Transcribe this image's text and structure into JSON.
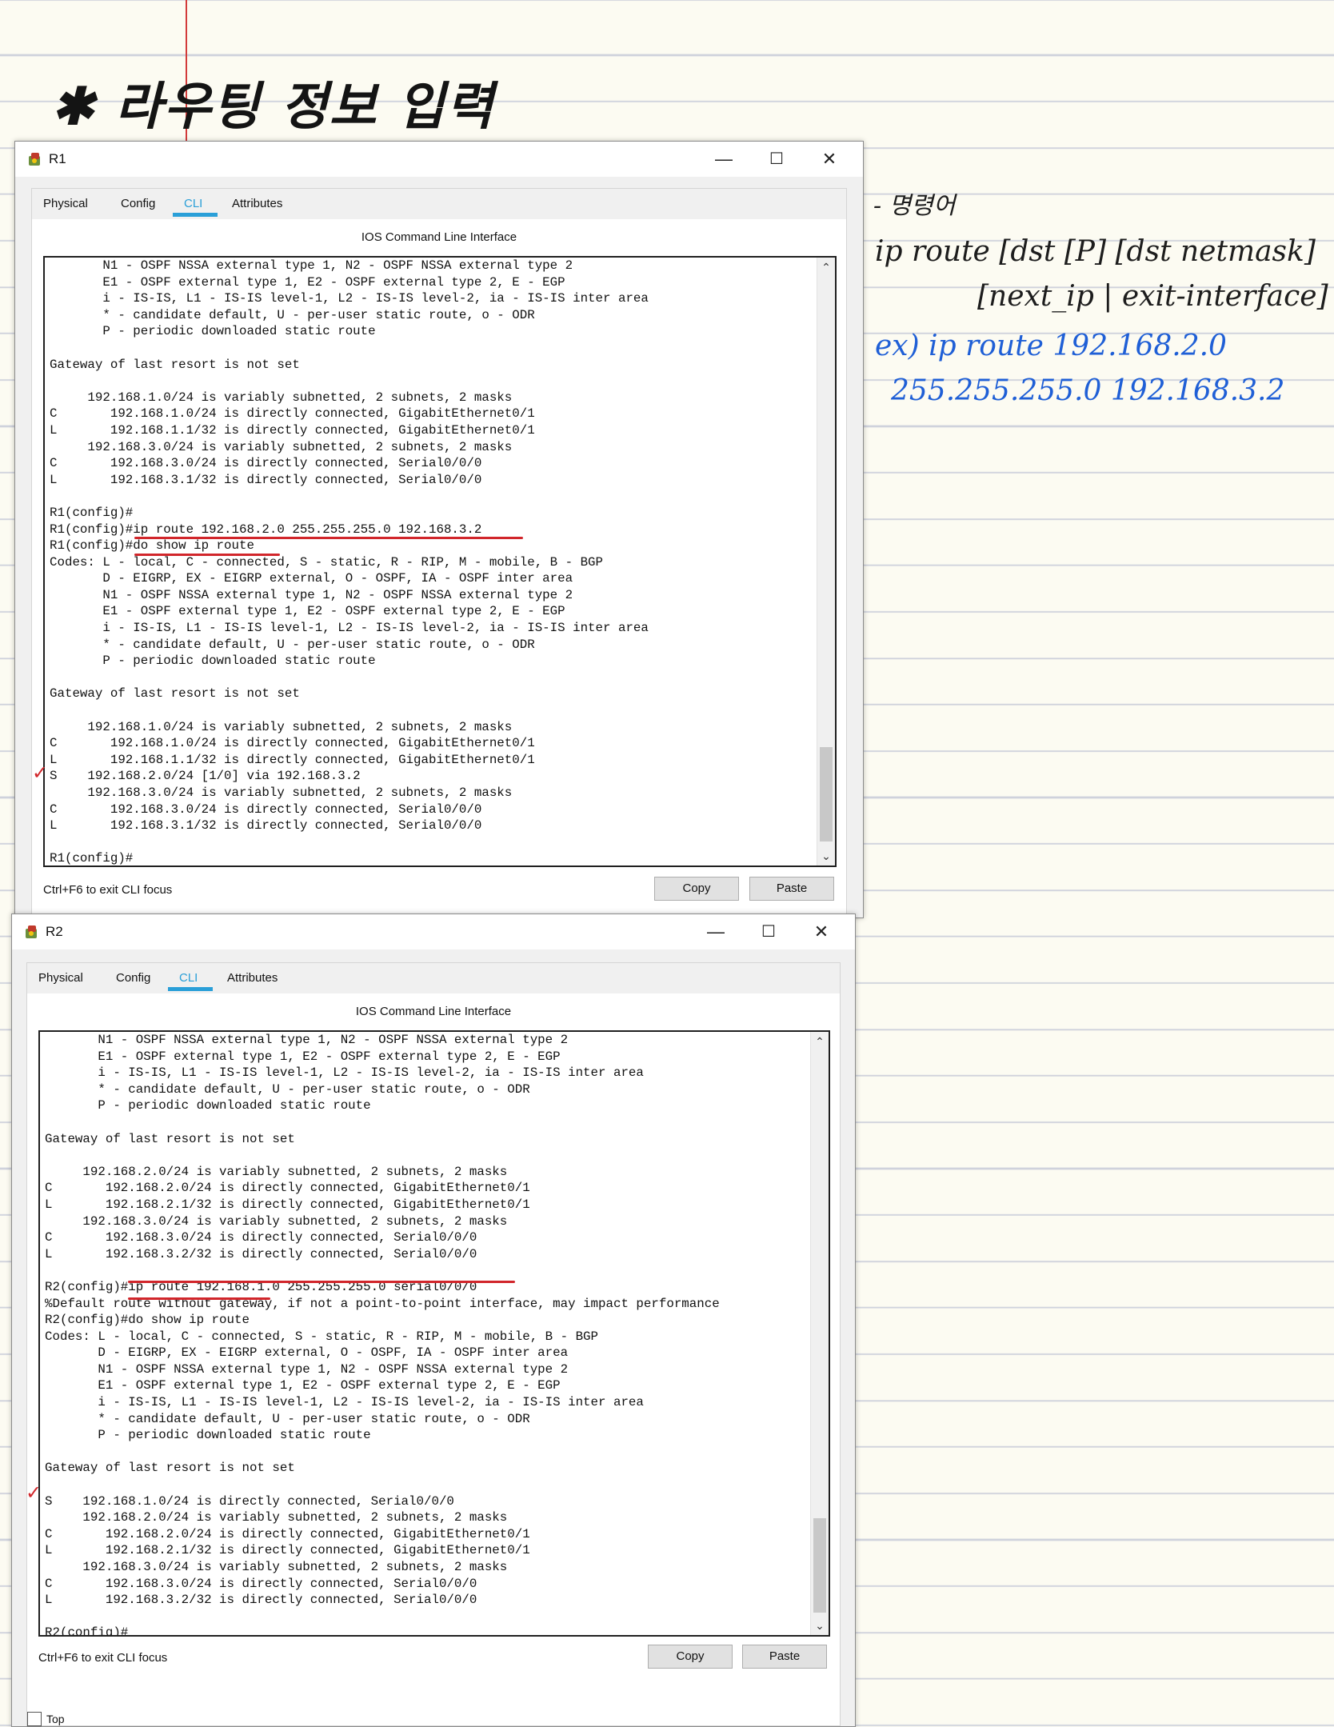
{
  "notes": {
    "title": "✱ 라우팅 정보 입력",
    "syntax_label": "- 명령어",
    "syntax_line1": "ip route [dst [P] [dst netmask]",
    "syntax_line2": "[next_ip | exit-interface]",
    "example_line1": "ex) ip route  192.168.2.0",
    "example_line2": "255.255.255.0   192.168.3.2"
  },
  "window_r1": {
    "title": "R1",
    "tabs": [
      "Physical",
      "Config",
      "CLI",
      "Attributes"
    ],
    "active_tab": "CLI",
    "header": "IOS Command Line Interface",
    "terminal": "       N1 - OSPF NSSA external type 1, N2 - OSPF NSSA external type 2\n       E1 - OSPF external type 1, E2 - OSPF external type 2, E - EGP\n       i - IS-IS, L1 - IS-IS level-1, L2 - IS-IS level-2, ia - IS-IS inter area\n       * - candidate default, U - per-user static route, o - ODR\n       P - periodic downloaded static route\n\nGateway of last resort is not set\n\n     192.168.1.0/24 is variably subnetted, 2 subnets, 2 masks\nC       192.168.1.0/24 is directly connected, GigabitEthernet0/1\nL       192.168.1.1/32 is directly connected, GigabitEthernet0/1\n     192.168.3.0/24 is variably subnetted, 2 subnets, 2 masks\nC       192.168.3.0/24 is directly connected, Serial0/0/0\nL       192.168.3.1/32 is directly connected, Serial0/0/0\n\nR1(config)#\nR1(config)#ip route 192.168.2.0 255.255.255.0 192.168.3.2\nR1(config)#do show ip route\nCodes: L - local, C - connected, S - static, R - RIP, M - mobile, B - BGP\n       D - EIGRP, EX - EIGRP external, O - OSPF, IA - OSPF inter area\n       N1 - OSPF NSSA external type 1, N2 - OSPF NSSA external type 2\n       E1 - OSPF external type 1, E2 - OSPF external type 2, E - EGP\n       i - IS-IS, L1 - IS-IS level-1, L2 - IS-IS level-2, ia - IS-IS inter area\n       * - candidate default, U - per-user static route, o - ODR\n       P - periodic downloaded static route\n\nGateway of last resort is not set\n\n     192.168.1.0/24 is variably subnetted, 2 subnets, 2 masks\nC       192.168.1.0/24 is directly connected, GigabitEthernet0/1\nL       192.168.1.1/32 is directly connected, GigabitEthernet0/1\nS    192.168.2.0/24 [1/0] via 192.168.3.2\n     192.168.3.0/24 is variably subnetted, 2 subnets, 2 masks\nC       192.168.3.0/24 is directly connected, Serial0/0/0\nL       192.168.3.1/32 is directly connected, Serial0/0/0\n\nR1(config)#",
    "hint": "Ctrl+F6 to exit CLI focus",
    "copy": "Copy",
    "paste": "Paste"
  },
  "window_r2": {
    "title": "R2",
    "tabs": [
      "Physical",
      "Config",
      "CLI",
      "Attributes"
    ],
    "active_tab": "CLI",
    "header": "IOS Command Line Interface",
    "terminal": "       N1 - OSPF NSSA external type 1, N2 - OSPF NSSA external type 2\n       E1 - OSPF external type 1, E2 - OSPF external type 2, E - EGP\n       i - IS-IS, L1 - IS-IS level-1, L2 - IS-IS level-2, ia - IS-IS inter area\n       * - candidate default, U - per-user static route, o - ODR\n       P - periodic downloaded static route\n\nGateway of last resort is not set\n\n     192.168.2.0/24 is variably subnetted, 2 subnets, 2 masks\nC       192.168.2.0/24 is directly connected, GigabitEthernet0/1\nL       192.168.2.1/32 is directly connected, GigabitEthernet0/1\n     192.168.3.0/24 is variably subnetted, 2 subnets, 2 masks\nC       192.168.3.0/24 is directly connected, Serial0/0/0\nL       192.168.3.2/32 is directly connected, Serial0/0/0\n\nR2(config)#ip route 192.168.1.0 255.255.255.0 serial0/0/0\n%Default route without gateway, if not a point-to-point interface, may impact performance\nR2(config)#do show ip route\nCodes: L - local, C - connected, S - static, R - RIP, M - mobile, B - BGP\n       D - EIGRP, EX - EIGRP external, O - OSPF, IA - OSPF inter area\n       N1 - OSPF NSSA external type 1, N2 - OSPF NSSA external type 2\n       E1 - OSPF external type 1, E2 - OSPF external type 2, E - EGP\n       i - IS-IS, L1 - IS-IS level-1, L2 - IS-IS level-2, ia - IS-IS inter area\n       * - candidate default, U - per-user static route, o - ODR\n       P - periodic downloaded static route\n\nGateway of last resort is not set\n\nS    192.168.1.0/24 is directly connected, Serial0/0/0\n     192.168.2.0/24 is variably subnetted, 2 subnets, 2 masks\nC       192.168.2.0/24 is directly connected, GigabitEthernet0/1\nL       192.168.2.1/32 is directly connected, GigabitEthernet0/1\n     192.168.3.0/24 is variably subnetted, 2 subnets, 2 masks\nC       192.168.3.0/24 is directly connected, Serial0/0/0\nL       192.168.3.2/32 is directly connected, Serial0/0/0\n\nR2(config)#",
    "hint": "Ctrl+F6 to exit CLI focus",
    "copy": "Copy",
    "paste": "Paste",
    "top_label": "Top"
  },
  "colors": {
    "accent": "#2a9fd8",
    "annotation_red": "#d1262b",
    "ink_blue": "#1f5fd6"
  },
  "icons": {
    "app": "router-app-icon",
    "minimize": "minimize-icon",
    "maximize": "maximize-icon",
    "close": "close-icon"
  }
}
